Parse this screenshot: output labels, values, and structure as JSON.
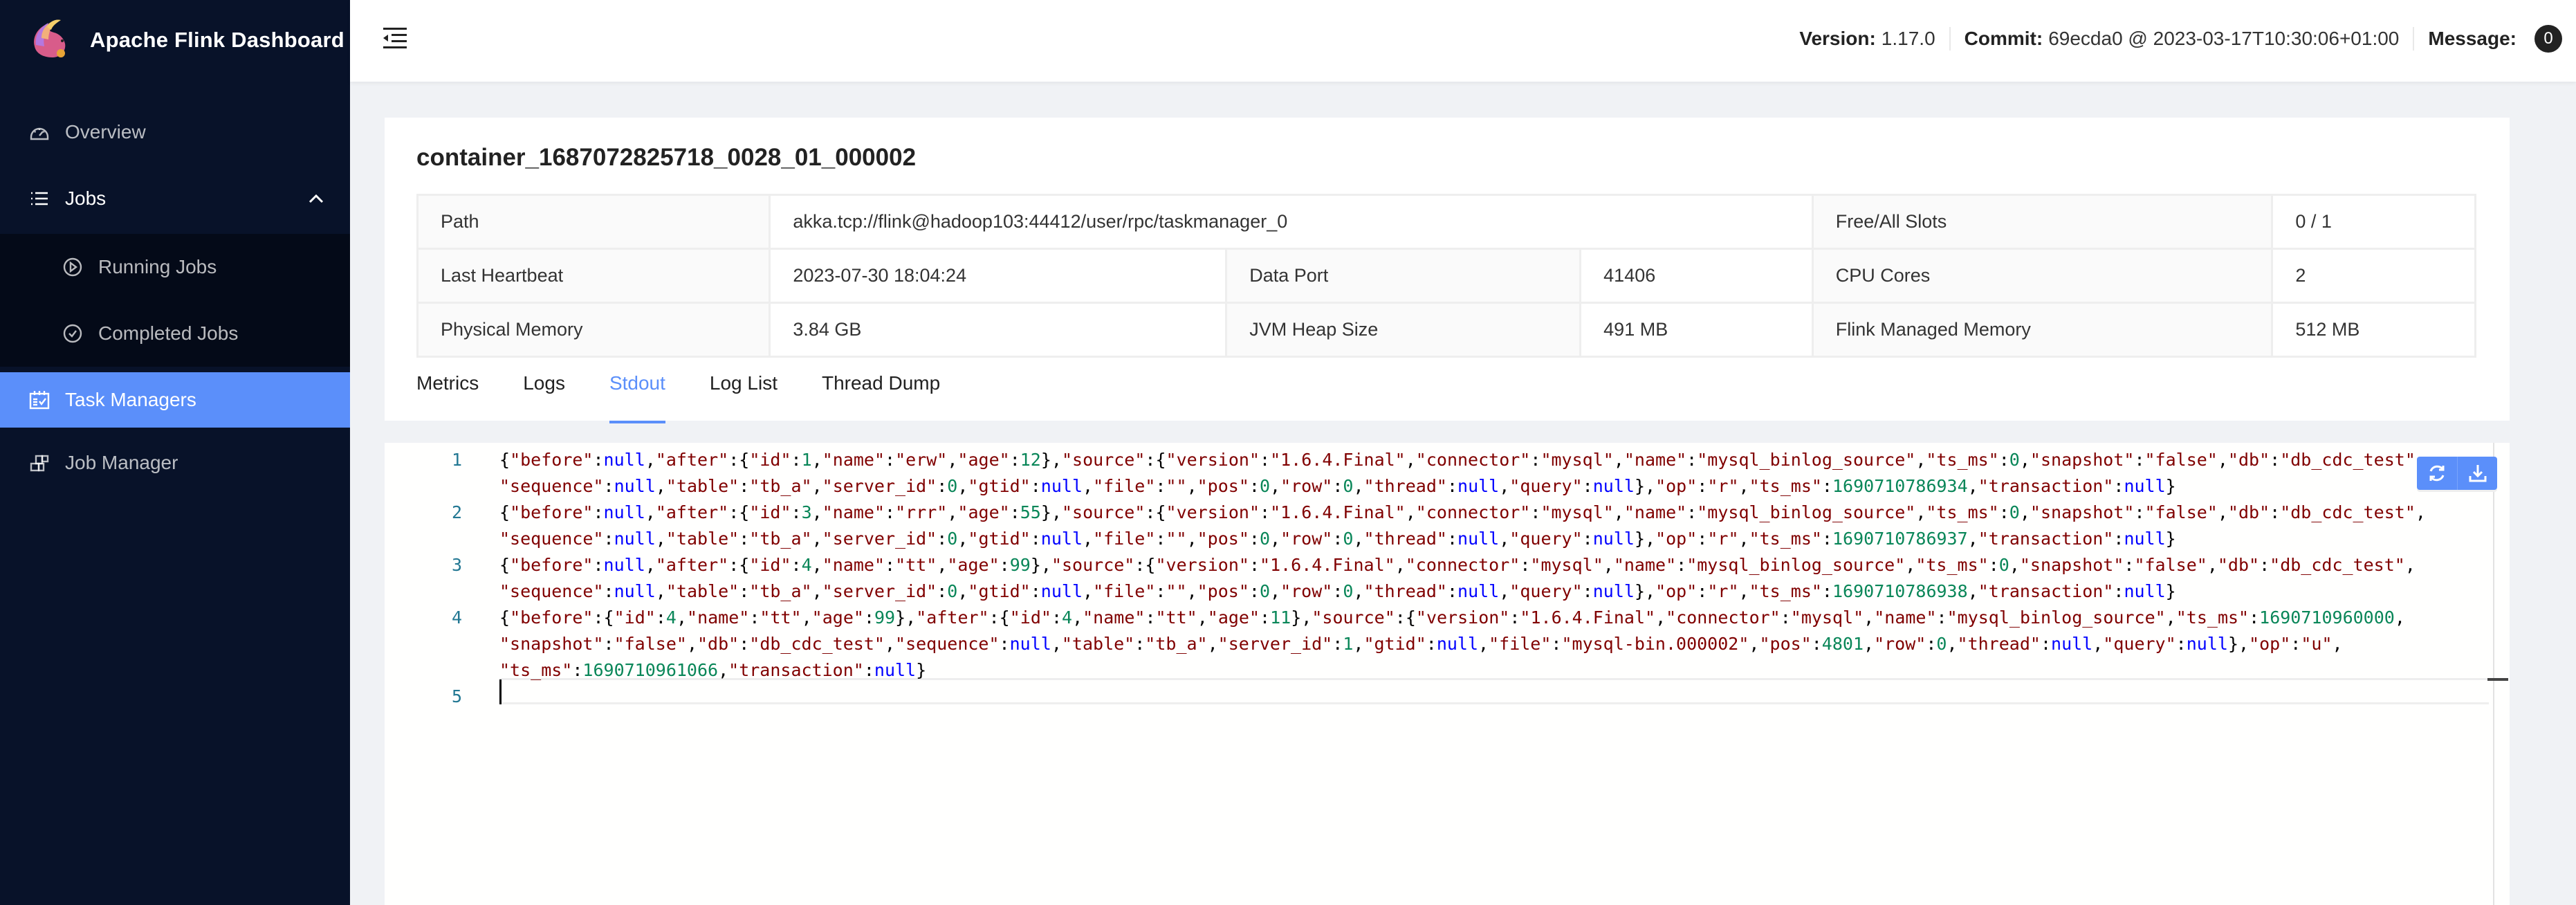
{
  "app": {
    "title": "Apache Flink Dashboard",
    "accent_color": "#5b8ffa",
    "sidebar_bg": "#081229"
  },
  "sidebar": {
    "items": [
      {
        "label": "Overview",
        "icon": "dashboard-icon"
      },
      {
        "label": "Jobs",
        "icon": "list-icon",
        "expanded": true,
        "children": [
          {
            "label": "Running Jobs",
            "icon": "play-circle-icon"
          },
          {
            "label": "Completed Jobs",
            "icon": "check-circle-icon"
          }
        ]
      },
      {
        "label": "Task Managers",
        "icon": "schedule-icon",
        "active": true
      },
      {
        "label": "Job Manager",
        "icon": "build-icon"
      }
    ]
  },
  "header": {
    "version_label": "Version:",
    "version_value": "1.17.0",
    "commit_label": "Commit:",
    "commit_value": "69ecda0 @ 2023-03-17T10:30:06+01:00",
    "message_label": "Message:",
    "message_count": "0"
  },
  "taskmanager": {
    "id": "container_1687072825718_0028_01_000002",
    "details": {
      "path_label": "Path",
      "path_value": "akka.tcp://flink@hadoop103:44412/user/rpc/taskmanager_0",
      "slots_label": "Free/All Slots",
      "slots_value": "0 / 1",
      "heartbeat_label": "Last Heartbeat",
      "heartbeat_value": "2023-07-30 18:04:24",
      "data_port_label": "Data Port",
      "data_port_value": "41406",
      "cpu_label": "CPU Cores",
      "cpu_value": "2",
      "phys_mem_label": "Physical Memory",
      "phys_mem_value": "3.84 GB",
      "heap_label": "JVM Heap Size",
      "heap_value": "491 MB",
      "managed_label": "Flink Managed Memory",
      "managed_value": "512 MB"
    },
    "tabs": [
      {
        "label": "Metrics"
      },
      {
        "label": "Logs"
      },
      {
        "label": "Stdout",
        "active": true
      },
      {
        "label": "Log List"
      },
      {
        "label": "Thread Dump"
      }
    ]
  },
  "stdout": {
    "lines": [
      {
        "num": "1",
        "text": "{\"before\":null,\"after\":{\"id\":1,\"name\":\"erw\",\"age\":12},\"source\":{\"version\":\"1.6.4.Final\",\"connector\":\"mysql\",\"name\":\"mysql_binlog_source\",\"ts_ms\":0,\"snapshot\":\"false\",\"db\":\"db_cdc_test\",\"sequence\":null,\"table\":\"tb_a\",\"server_id\":0,\"gtid\":null,\"file\":\"\",\"pos\":0,\"row\":0,\"thread\":null,\"query\":null},\"op\":\"r\",\"ts_ms\":169071078693​4,\"transaction\":null}"
      },
      {
        "num": "2",
        "text": "{\"before\":null,\"after\":{\"id\":3,\"name\":\"rrr\",\"age\":55},\"source\":{\"version\":\"1.6.4.Final\",\"connector\":\"mysql\",\"name\":\"mysql_binlog_source\",\"ts_ms\":0,\"snapshot\":\"false\",\"db\":\"db_cdc_test\",\"sequence\":null,\"table\":\"tb_a\",\"server_id\":0,\"gtid\":null,\"file\":\"\",\"pos\":0,\"row\":0,\"thread\":null,\"query\":null},\"op\":\"r\",\"ts_ms\":1690710786937,\"transaction\":null}"
      },
      {
        "num": "3",
        "text": "{\"before\":null,\"after\":{\"id\":4,\"name\":\"tt\",\"age\":99},\"source\":{\"version\":\"1.6.4.Final\",\"connector\":\"mysql\",\"name\":\"mysql_binlog_source\",\"ts_ms\":0,\"snapshot\":\"false\",\"db\":\"db_cdc_test\",\"sequence\":null,\"table\":\"tb_a\",\"server_id\":0,\"gtid\":null,\"file\":\"\",\"pos\":0,\"row\":0,\"thread\":null,\"query\":null},\"op\":\"r\",\"ts_ms\":1690710786938,\"transaction\":null}"
      },
      {
        "num": "4",
        "text": "{\"before\":{\"id\":4,\"name\":\"tt\",\"age\":99},\"after\":{\"id\":4,\"name\":\"tt\",\"age\":11},\"source\":{\"version\":\"1.6.4.Final\",\"connector\":\"mysql\",\"name\":\"mysql_binlog_source\",\"ts_ms\":1690710960000,\"snapshot\":\"false\",\"db\":\"db_cdc_test\",\"sequence\":null,\"table\":\"tb_a\",\"server_id\":1,\"gtid\":null,\"file\":\"mysql-bin.000002\",\"pos\":4801,\"row\":0,\"thread\":null,\"query\":null},\"op\":\"u\",\"ts_ms\":1690710961066,\"transaction\":null}"
      },
      {
        "num": "5",
        "text": ""
      }
    ],
    "wrapped": [
      [
        "{\"before\":null,\"after\":{\"id\":1,\"name\":\"erw\",\"age\":12},\"source\":{\"version\":\"1.6.4.Final\",\"connector\":\"mysql\",\"name\":\"mysql_binlog_source\",\"ts_ms\":0,\"snapshot\":\"false\",\"db\":\"db_cdc_test\",",
        "\"sequence\":null,\"table\":\"tb_a\",\"server_id\":0,\"gtid\":null,\"file\":\"\",\"pos\":0,\"row\":0,\"thread\":null,\"query\":null},\"op\":\"r\",\"ts_ms\":1690710786934,\"transaction\":null}"
      ],
      [
        "{\"before\":null,\"after\":{\"id\":3,\"name\":\"rrr\",\"age\":55},\"source\":{\"version\":\"1.6.4.Final\",\"connector\":\"mysql\",\"name\":\"mysql_binlog_source\",\"ts_ms\":0,\"snapshot\":\"false\",\"db\":\"db_cdc_test\",",
        "\"sequence\":null,\"table\":\"tb_a\",\"server_id\":0,\"gtid\":null,\"file\":\"\",\"pos\":0,\"row\":0,\"thread\":null,\"query\":null},\"op\":\"r\",\"ts_ms\":1690710786937,\"transaction\":null}"
      ],
      [
        "{\"before\":null,\"after\":{\"id\":4,\"name\":\"tt\",\"age\":99},\"source\":{\"version\":\"1.6.4.Final\",\"connector\":\"mysql\",\"name\":\"mysql_binlog_source\",\"ts_ms\":0,\"snapshot\":\"false\",\"db\":\"db_cdc_test\",",
        "\"sequence\":null,\"table\":\"tb_a\",\"server_id\":0,\"gtid\":null,\"file\":\"\",\"pos\":0,\"row\":0,\"thread\":null,\"query\":null},\"op\":\"r\",\"ts_ms\":1690710786938,\"transaction\":null}"
      ],
      [
        "{\"before\":{\"id\":4,\"name\":\"tt\",\"age\":99},\"after\":{\"id\":4,\"name\":\"tt\",\"age\":11},\"source\":{\"version\":\"1.6.4.Final\",\"connector\":\"mysql\",\"name\":\"mysql_binlog_source\",\"ts_ms\":1690710960000,",
        "\"snapshot\":\"false\",\"db\":\"db_cdc_test\",\"sequence\":null,\"table\":\"tb_a\",\"server_id\":1,\"gtid\":null,\"file\":\"mysql-bin.000002\",\"pos\":4801,\"row\":0,\"thread\":null,\"query\":null},\"op\":\"u\",",
        "\"ts_ms\":1690710961066,\"transaction\":null}"
      ],
      [
        ""
      ]
    ],
    "actions": [
      {
        "name": "reload",
        "icon": "reload-icon"
      },
      {
        "name": "download",
        "icon": "download-icon"
      }
    ]
  }
}
